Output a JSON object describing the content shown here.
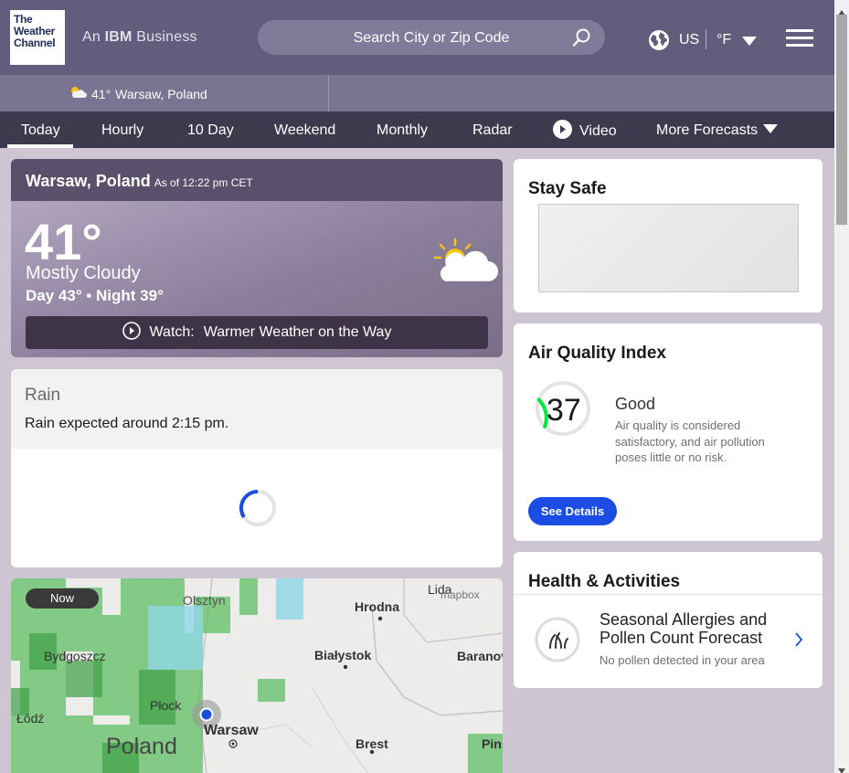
{
  "header": {
    "logo_lines": [
      "The",
      "Weather",
      "Channel"
    ],
    "tagline_prefix": "An",
    "tagline_brand": "IBM",
    "tagline_suffix": "Business",
    "search_placeholder": "Search City or Zip Code",
    "locale": "US",
    "unit": "°F"
  },
  "recent_locations": [
    {
      "temp": "41°",
      "name": "Warsaw, Poland",
      "icon": "partly-cloudy-icon"
    }
  ],
  "nav": {
    "items": [
      "Today",
      "Hourly",
      "10 Day",
      "Weekend",
      "Monthly",
      "Radar",
      "Video",
      "More Forecasts"
    ],
    "active": "Today"
  },
  "current": {
    "city": "Warsaw, Poland",
    "as_of": "As of 12:22 pm CET",
    "temperature": "41°",
    "phrase": "Mostly Cloudy",
    "day_night": "Day 43° • Night 39°",
    "watch_label": "Watch:",
    "watch_title": "Warmer Weather on the Way",
    "icon": "partly-cloudy-icon"
  },
  "rain": {
    "title": "Rain",
    "message": "Rain expected around 2:15 pm."
  },
  "map": {
    "now_label": "Now",
    "attribution": "mapbox",
    "places": [
      "Olsztyn",
      "Lida",
      "Hrodna",
      "Bydgoszcz",
      "Białystok",
      "Baranov",
      "Płock",
      "Warsaw",
      "Poland",
      "Brest",
      "Pins",
      "Łódź"
    ]
  },
  "stay_safe": {
    "title": "Stay Safe"
  },
  "air_quality": {
    "title": "Air Quality Index",
    "value": 37,
    "value_text": "37",
    "category": "Good",
    "description": "Air quality is considered satisfactory, and air pollution poses little or no risk.",
    "button": "See Details",
    "color": "#00e838"
  },
  "health": {
    "title": "Health & Activities",
    "item_title": "Seasonal Allergies and Pollen Count Forecast",
    "item_subtitle": "No pollen detected in your area"
  },
  "colors": {
    "header_bg": "#625c7d",
    "nav_bg": "#3d3a4e",
    "accent_blue": "#1b4de4"
  }
}
